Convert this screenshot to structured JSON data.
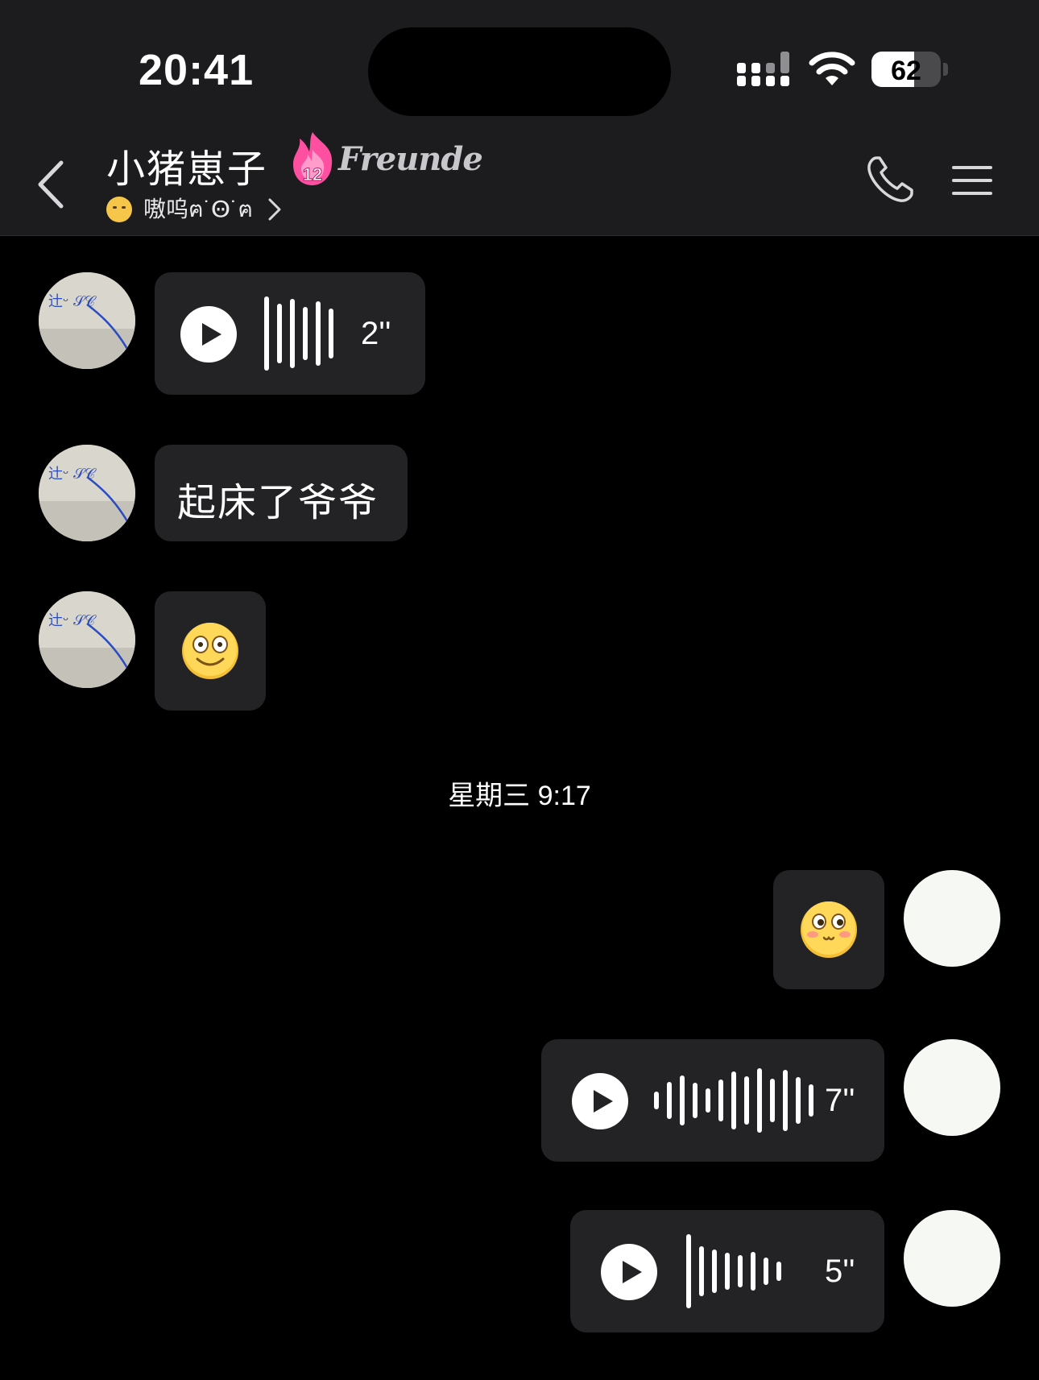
{
  "status_bar": {
    "time": "20:41",
    "battery": 62
  },
  "header": {
    "title": "小猪崽子",
    "streak_count": "12",
    "badge_text": "Freunde",
    "status_text": "嗷呜ฅ˙Ꙫ˙ฅ"
  },
  "messages": [
    {
      "side": "in",
      "type": "voice",
      "duration": "2''"
    },
    {
      "side": "in",
      "type": "text",
      "text": "起床了爷爷"
    },
    {
      "side": "in",
      "type": "emoji",
      "emoji": "smile-emoji"
    },
    {
      "side": "system",
      "type": "timestamp",
      "text": "星期三 9:17"
    },
    {
      "side": "out",
      "type": "emoji",
      "emoji": "blush-emoji"
    },
    {
      "side": "out",
      "type": "voice",
      "duration": "7''"
    },
    {
      "side": "out",
      "type": "voice",
      "duration": "5''"
    }
  ],
  "colors": {
    "background": "#000000",
    "bar": "#1c1c1e",
    "bubble": "#232325",
    "flame": "#ff4fa0"
  }
}
